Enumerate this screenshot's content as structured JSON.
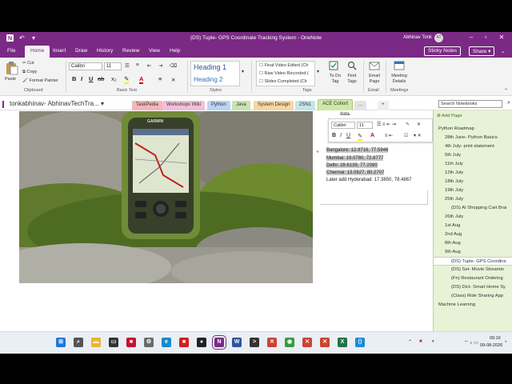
{
  "window": {
    "title": "(DS) Tuple- GPS Coordinate Tracking System  -  OneNote",
    "user": "Abhinav Tonk",
    "avatar_initials": "AT",
    "accent": "#7a2a84"
  },
  "menu": {
    "items": [
      "File",
      "Home",
      "Insert",
      "Draw",
      "History",
      "Review",
      "View",
      "Help"
    ],
    "sticky_notes": "Sticky Notes",
    "share": "Share"
  },
  "ribbon": {
    "clipboard": {
      "paste": "Paste",
      "cut": "Cut",
      "copy": "Copy",
      "format_painter": "Format Painter",
      "label": "Clipboard"
    },
    "basic_text": {
      "font": "Calibri",
      "size": "11",
      "label": "Basic Text"
    },
    "styles": {
      "heading1": "Heading 1",
      "heading2": "Heading 2",
      "label": "Styles"
    },
    "tags": {
      "items": [
        "Final Video Edited (Ch",
        "Raw Video Recorded (",
        "Slides Completed (Clr"
      ],
      "label": "Tags"
    },
    "todo": {
      "todo_tag": "To Do Tag",
      "find_tags": "Find Tags"
    },
    "email": {
      "email_page": "Email Page",
      "label": "Email"
    },
    "meetings": {
      "meeting_details": "Meeting Details",
      "label": "Meetings"
    }
  },
  "notebook": {
    "name": "tonkabhinav- AbhinavTechTra...",
    "sections": [
      {
        "label": "TaskPedia",
        "color": "#f4b6b6"
      },
      {
        "label": "Workshops Wiki",
        "color": "#f0c0d8"
      },
      {
        "label": "Python",
        "color": "#b8d4f2"
      },
      {
        "label": "Java",
        "color": "#c6e5b0"
      },
      {
        "label": "System Design",
        "color": "#f7d6a2"
      },
      {
        "label": "2SN1",
        "color": "#c2e6e6"
      },
      {
        "label": "ACE Cohort",
        "color": "#cfe8a6"
      },
      {
        "label": "...",
        "color": "#e3e3e3"
      }
    ],
    "add_section": "+",
    "search_placeholder": "Search Notebooks"
  },
  "page": {
    "top_text": "data.",
    "lines": [
      "Bangalore: 12.9716, 77.5946",
      "Mumbai: 19.0760, 72.8777",
      "Delhi: 28.6139, 77.2090",
      "Chennai: 13.0827, 80.2707",
      "Later add Hyderabad: 17.3850, 78.4867"
    ],
    "gps_brand": "GARMIN"
  },
  "mini_toolbar": {
    "font": "Calibri",
    "size": "11"
  },
  "pages_pane": {
    "add_page": "Add Page",
    "items": [
      {
        "label": "Python Roadmap",
        "level": 0
      },
      {
        "label": "28th June- Python Basics",
        "level": 1
      },
      {
        "label": "4th July- print statement",
        "level": 1
      },
      {
        "label": "5th July",
        "level": 1
      },
      {
        "label": "11th July",
        "level": 1
      },
      {
        "label": "12th July",
        "level": 1
      },
      {
        "label": "18th July",
        "level": 1
      },
      {
        "label": "19th July",
        "level": 1
      },
      {
        "label": "25th July",
        "level": 1
      },
      {
        "label": "(DS) AI Shopping Cart Brai",
        "level": 2
      },
      {
        "label": "26th July",
        "level": 1
      },
      {
        "label": "1st Aug",
        "level": 1
      },
      {
        "label": "2nd Aug",
        "level": 1
      },
      {
        "label": "8th Aug",
        "level": 1
      },
      {
        "label": "9th Aug",
        "level": 1
      },
      {
        "label": "(DS) Tuple- GPS Coordina",
        "level": 2,
        "selected": true
      },
      {
        "label": "(DS) Set- Movie Streamin",
        "level": 2
      },
      {
        "label": "(Fn) Restaurant Ordering",
        "level": 2
      },
      {
        "label": "(DS) Dict- Smart Home Sy",
        "level": 2
      },
      {
        "label": "(Class) Ride Sharing App",
        "level": 2
      },
      {
        "label": "Machine Learning",
        "level": 0
      }
    ]
  },
  "taskbar": {
    "icons": [
      "windows-start",
      "search",
      "file-explorer",
      "task-view",
      "app-red",
      "settings",
      "edge",
      "app-red2",
      "app-dark",
      "onenote",
      "word",
      "terminal",
      "app-x",
      "chrome",
      "app-x2",
      "app-x3",
      "excel",
      "vscode"
    ],
    "tray": {
      "lang": "ENG IN",
      "time": "09:16",
      "date": "09-08-2026"
    }
  }
}
